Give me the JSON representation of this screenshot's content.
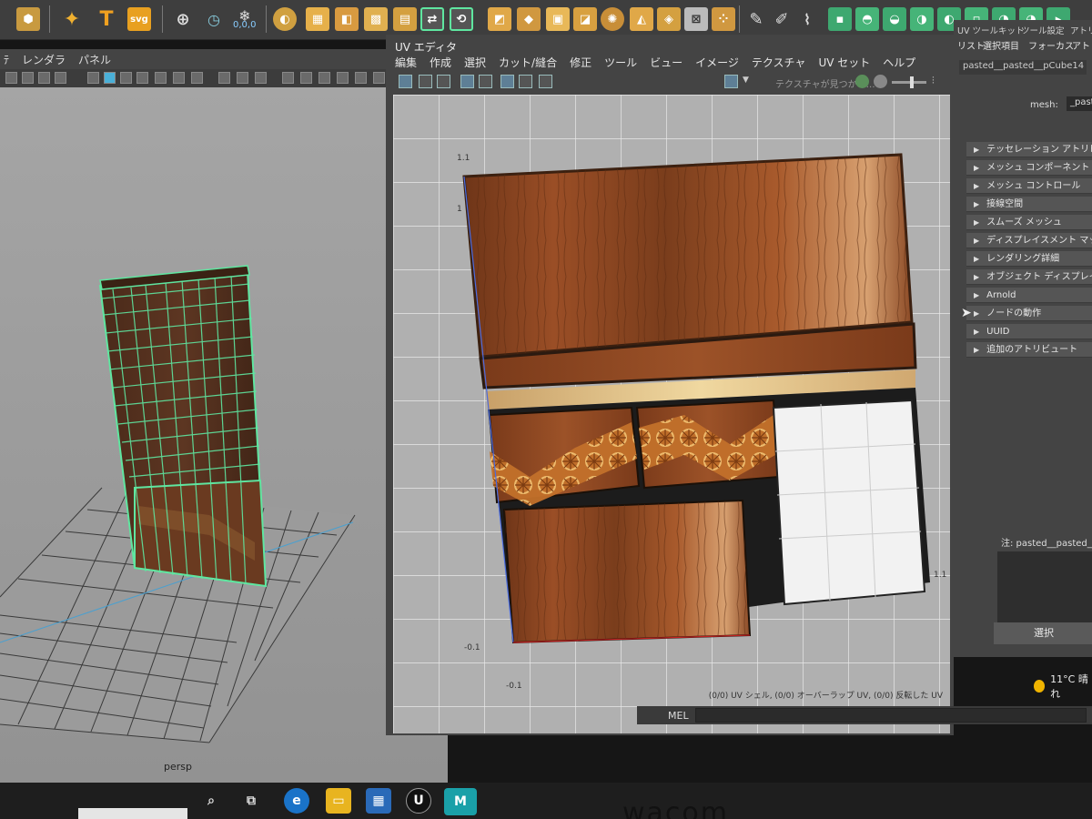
{
  "shelf": {
    "text_icon_label": "T",
    "svg_icon_label": "svg",
    "coords_label": "0,0,0"
  },
  "viewport": {
    "menu": [
      "ﾃ",
      "レンダラ",
      "パネル"
    ],
    "camera_label": "persp"
  },
  "uv_editor": {
    "title": "UV エディタ",
    "menu": [
      "編集",
      "作成",
      "選択",
      "カット/縫合",
      "修正",
      "ツール",
      "ビュー",
      "イメージ",
      "テクスチャ",
      "UV セット",
      "ヘルプ"
    ],
    "texture_message": "テクスチャが見つかり…",
    "axis_labels": [
      "1.1",
      "1",
      "-0.1",
      "-0.1",
      "1.1"
    ],
    "status_text": "(0/0) UV シェル, (0/0) オーバーラップ UV, (0/0) 反転した UV"
  },
  "mel": {
    "label": "MEL"
  },
  "attribute_editor": {
    "tabs": [
      "UV ツールキット",
      "ツール設定",
      "アトリビ"
    ],
    "subtabs": [
      "リスト",
      "選択項目",
      "フォーカス",
      "アトリビュ"
    ],
    "node_tab": "pasted__pasted__pCube14",
    "node_tab_short": "pa",
    "mesh_label": "mesh:",
    "mesh_value": "_pasted",
    "sections": [
      "テッセレーション アトリビュート",
      "メッシュ コンポーネント ディスプレ",
      "メッシュ コントロール",
      "接線空間",
      "スムーズ メッシュ",
      "ディスプレイスメント マップ",
      "レンダリング詳細",
      "オブジェクト ディスプレイ",
      "Arnold",
      "ノードの動作",
      "UUID",
      "追加のアトリビュート"
    ],
    "notes_label": "注: pasted__pasted__pCube",
    "select_button": "選択"
  },
  "taskbar": {
    "weather": "11°C 晴れ",
    "brand_text": "wacom"
  },
  "colors": {
    "wood": "#8b4a26",
    "selection_green": "#5fe6a0",
    "accent_blue": "#4a90c8"
  }
}
